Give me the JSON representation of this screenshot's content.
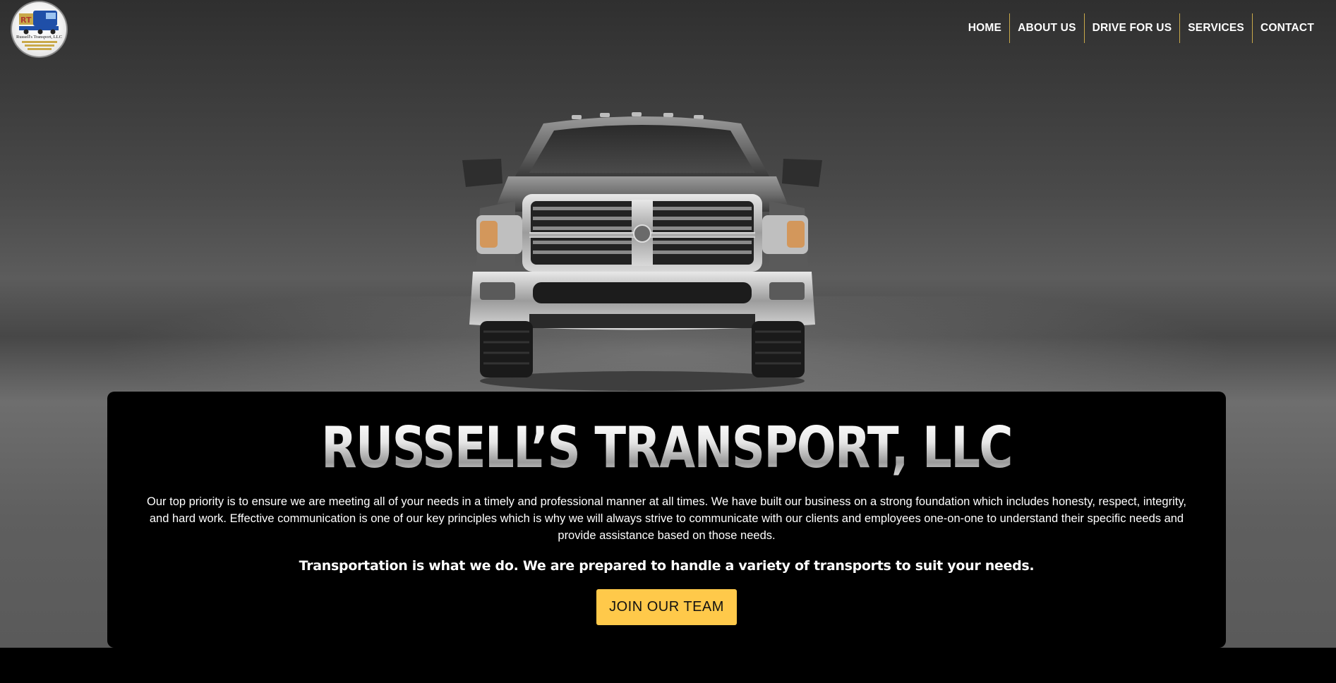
{
  "logo": {
    "text": "Russell's Transport, LLC"
  },
  "nav": {
    "items": [
      {
        "label": "HOME"
      },
      {
        "label": "ABOUT US"
      },
      {
        "label": "DRIVE FOR US"
      },
      {
        "label": "SERVICES"
      },
      {
        "label": "CONTACT"
      }
    ]
  },
  "hero": {
    "title": "RUSSELL’S TRANSPORT, LLC",
    "description": "Our top priority is to ensure we are meeting all of your needs in a timely and professional manner at all times. We have built our business on a strong foundation which includes honesty, respect, integrity, and hard work. Effective communication is one of our key principles which is why we will always strive to communicate with our clients and employees one-on-one to understand their specific needs and provide assistance based on those needs.",
    "tagline": "Transportation is what we do. We are prepared to handle a variety of transports to suit your needs.",
    "cta_label": "JOIN OUR TEAM"
  },
  "colors": {
    "accent": "#ffc94a",
    "panel": "#000000",
    "nav_divider": "#c9a94a"
  }
}
